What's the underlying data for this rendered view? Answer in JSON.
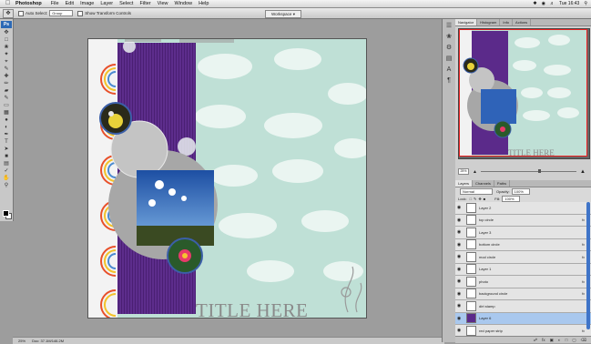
{
  "menubar": {
    "app": "Photoshop",
    "items": [
      "File",
      "Edit",
      "Image",
      "Layer",
      "Select",
      "Filter",
      "View",
      "Window",
      "Help"
    ],
    "clock": "Tue 16:43"
  },
  "options": {
    "auto_select": "Auto Select:",
    "auto_select_value": "Group",
    "show_transform": "Show Transform Controls",
    "workspace": "Workspace"
  },
  "document": {
    "title_text": "TITLE HERE"
  },
  "status": {
    "zoom": "25%",
    "doc_info": "Doc: 37.1M/146.2M"
  },
  "navigator": {
    "tabs": [
      "Navigator",
      "Histogram",
      "Info",
      "Actions"
    ],
    "zoom": "25%"
  },
  "layers_panel": {
    "tabs": [
      "Layers",
      "Channels",
      "Paths"
    ],
    "blend_mode": "Normal",
    "opacity_label": "Opacity:",
    "opacity": "100%",
    "lock_label": "Lock:",
    "fill_label": "Fill:",
    "fill": "100%",
    "layers": [
      {
        "name": "Layer 2",
        "fx": false,
        "selected": false
      },
      {
        "name": "top circle",
        "fx": true,
        "selected": false
      },
      {
        "name": "Layer 3",
        "fx": false,
        "selected": false
      },
      {
        "name": "bottom circle",
        "fx": true,
        "selected": false
      },
      {
        "name": "mod circle",
        "fx": true,
        "selected": false
      },
      {
        "name": "Layer 1",
        "fx": false,
        "selected": false
      },
      {
        "name": "photo",
        "fx": true,
        "selected": false
      },
      {
        "name": "background circle",
        "fx": true,
        "selected": false
      },
      {
        "name": "dirt stamp",
        "fx": false,
        "selected": false
      },
      {
        "name": "Layer 6",
        "fx": false,
        "selected": true
      },
      {
        "name": "red paper strip",
        "fx": true,
        "selected": false
      }
    ]
  },
  "colors": {
    "page_bg": "#bfe0d6",
    "purple": "#5b2a8a",
    "accent_blue": "#3f74c8"
  }
}
